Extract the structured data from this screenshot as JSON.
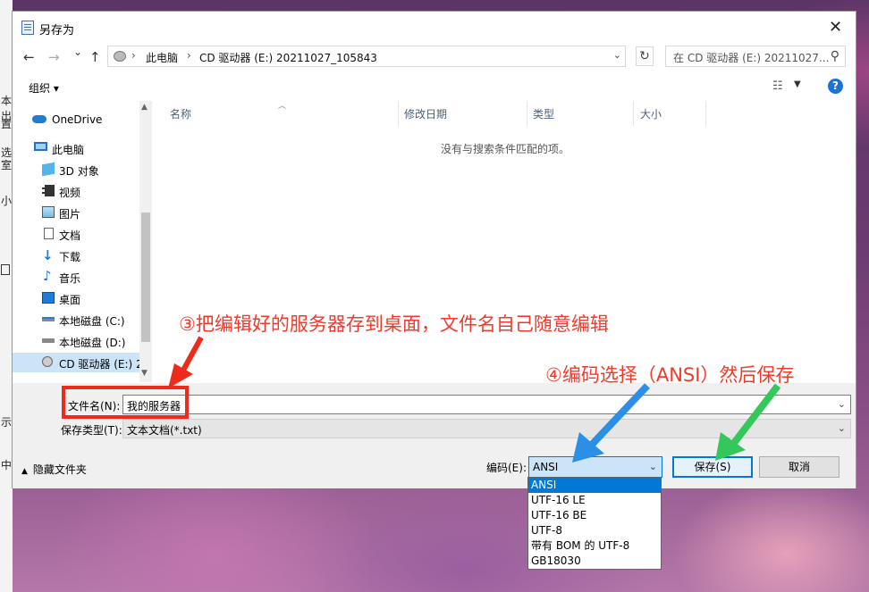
{
  "dialog": {
    "title": "另存为",
    "close_glyph": "✕"
  },
  "nav": {
    "back": "←",
    "forward": "→",
    "recent": "⌄",
    "up": "↑",
    "breadcrumb": [
      "此电脑",
      "CD 驱动器 (E:) 20211027_105843"
    ],
    "refresh": "↻",
    "search_placeholder": "在 CD 驱动器 (E:) 20211027..."
  },
  "toolbar": {
    "organize": "组织 ▾",
    "help": "?"
  },
  "sidebar": {
    "items": [
      {
        "label": "OneDrive",
        "icon": "cloud-icon"
      },
      {
        "label": "此电脑",
        "icon": "computer-icon"
      },
      {
        "label": "3D 对象",
        "icon": "cube-icon"
      },
      {
        "label": "视频",
        "icon": "video-icon"
      },
      {
        "label": "图片",
        "icon": "picture-icon"
      },
      {
        "label": "文档",
        "icon": "document-icon"
      },
      {
        "label": "下载",
        "icon": "download-icon"
      },
      {
        "label": "音乐",
        "icon": "music-icon"
      },
      {
        "label": "桌面",
        "icon": "desktop-icon"
      },
      {
        "label": "本地磁盘 (C:)",
        "icon": "drive-icon"
      },
      {
        "label": "本地磁盘 (D:)",
        "icon": "drive-icon"
      },
      {
        "label": "CD 驱动器 (E:) 2",
        "icon": "cd-drive-icon"
      }
    ]
  },
  "filelist": {
    "columns": [
      "名称",
      "修改日期",
      "类型",
      "大小"
    ],
    "empty_message": "没有与搜索条件匹配的项。"
  },
  "form": {
    "filename_label": "文件名(N):",
    "filename_value": "我的服务器",
    "filetype_label": "保存类型(T):",
    "filetype_value": "文本文档(*.txt)",
    "hide_folders": "隐藏文件夹",
    "encoding_label": "编码(E):",
    "encoding_value": "ANSI",
    "save_button": "保存(S)",
    "cancel_button": "取消"
  },
  "encoding_options": [
    "ANSI",
    "UTF-16 LE",
    "UTF-16 BE",
    "UTF-8",
    "带有 BOM 的 UTF-8",
    "GB18030"
  ],
  "annotations": {
    "step3": "③把编辑好的服务器存到桌面，文件名自己随意编辑",
    "step4": "④编码选择（ANSI）然后保存"
  },
  "background_fragments": [
    "本出",
    "置",
    "选",
    "室",
    "小",
    "示",
    "中"
  ],
  "colors": {
    "accent": "#0078d7",
    "annotation_red": "#f23a2a",
    "arrow_blue": "#2b8fe6",
    "arrow_green": "#34c759"
  }
}
